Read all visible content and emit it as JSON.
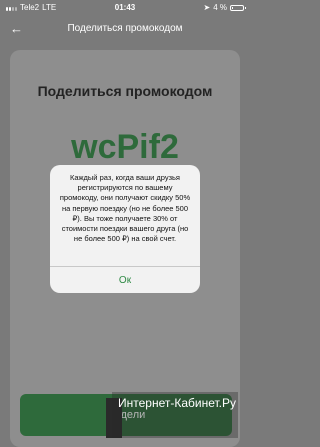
{
  "status_bar": {
    "carrier": "Tele2",
    "network": "LTE",
    "time": "01:43",
    "battery_text": "4 %",
    "battery_level": 0.04,
    "signal_bars_active": 2,
    "signal_bars_total": 4
  },
  "nav": {
    "title": "Поделиться промокодом",
    "back_icon": "back-arrow-icon"
  },
  "sheet": {
    "heading": "Поделиться промокодом",
    "promo_code": "wcPif2",
    "share_button_label": "Подели"
  },
  "alert": {
    "message": "Каждый раз, когда ваши друзья регистрируются по вашему промокоду, они получают скидку 50% на первую поездку (но не более 500 ₽). Вы тоже получаете 30% от стоимости поездки вашего друга (но не более 500 ₽) на свой счет.",
    "ok_label": "Ок"
  },
  "watermark": {
    "text": "Интернет-Кабинет.Ру"
  },
  "colors": {
    "accent_green": "#2e6a3b",
    "ok_green": "#2f8a45"
  }
}
